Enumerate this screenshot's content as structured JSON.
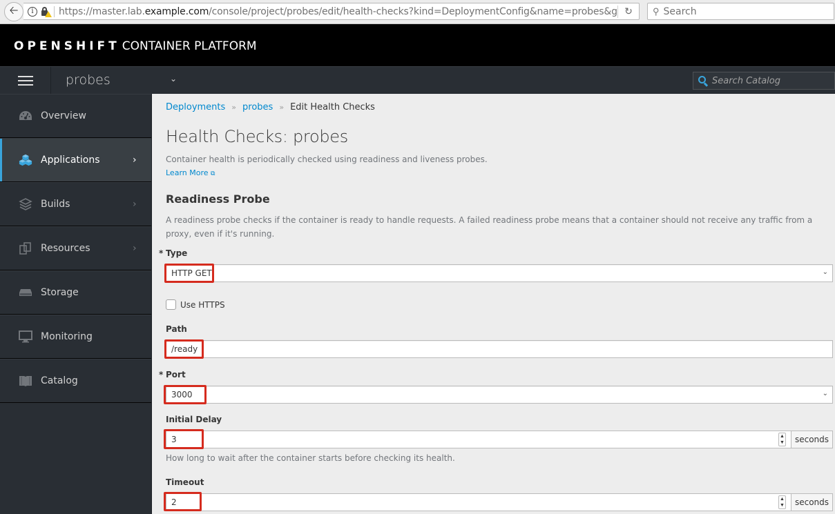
{
  "browser": {
    "url_prefix": "https://master.lab.",
    "url_host": "example.com",
    "url_suffix": "/console/project/probes/edit/health-checks?kind=DeploymentConfig&name=probes&group",
    "search_placeholder": "Search",
    "icons": {
      "back": "arrow-left-icon",
      "info": "info-icon",
      "lock": "lock-warning-icon",
      "reload": "reload-icon",
      "search": "search-icon"
    }
  },
  "masthead": {
    "brand_bold": "OPENSHIFT",
    "brand_light": "CONTAINER PLATFORM"
  },
  "project_bar": {
    "project_name": "probes",
    "catalog_search_placeholder": "Search Catalog"
  },
  "sidebar": {
    "items": [
      {
        "label": "Overview",
        "icon": "dashboard-icon",
        "active": false,
        "has_submenu": false
      },
      {
        "label": "Applications",
        "icon": "cubes-icon",
        "active": true,
        "has_submenu": true
      },
      {
        "label": "Builds",
        "icon": "layers-icon",
        "active": false,
        "has_submenu": true
      },
      {
        "label": "Resources",
        "icon": "resources-icon",
        "active": false,
        "has_submenu": true
      },
      {
        "label": "Storage",
        "icon": "storage-icon",
        "active": false,
        "has_submenu": false
      },
      {
        "label": "Monitoring",
        "icon": "monitor-icon",
        "active": false,
        "has_submenu": false
      },
      {
        "label": "Catalog",
        "icon": "book-icon",
        "active": false,
        "has_submenu": false
      }
    ]
  },
  "breadcrumb": {
    "items": [
      "Deployments",
      "probes"
    ],
    "current": "Edit Health Checks",
    "separator": "»"
  },
  "page": {
    "title": "Health Checks: probes",
    "description": "Container health is periodically checked using readiness and liveness probes.",
    "learn_more": "Learn More"
  },
  "readiness": {
    "title": "Readiness Probe",
    "description": "A readiness probe checks if the container is ready to handle requests. A failed readiness probe means that a container should not receive any traffic from a proxy, even if it's running.",
    "type_label": "Type",
    "type_value": "HTTP GET",
    "use_https_label": "Use HTTPS",
    "use_https_checked": false,
    "path_label": "Path",
    "path_value": "/ready",
    "port_label": "Port",
    "port_value": "3000",
    "initial_delay_label": "Initial Delay",
    "initial_delay_value": "3",
    "initial_delay_unit": "seconds",
    "initial_delay_help": "How long to wait after the container starts before checking its health.",
    "timeout_label": "Timeout",
    "timeout_value": "2",
    "timeout_unit": "seconds",
    "required_marker": "*"
  },
  "colors": {
    "accent": "#39a5dc",
    "link": "#0088ce",
    "highlight": "#d52b1e",
    "sidebar_bg": "#292e34",
    "masthead_bg": "#000000"
  }
}
